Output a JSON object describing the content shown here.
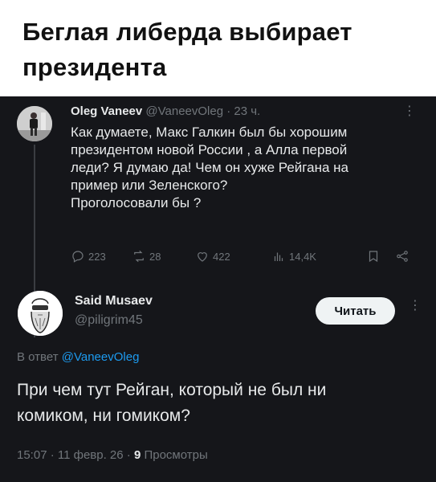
{
  "caption": {
    "title": "Беглая либерда выбирает\nпрезидента"
  },
  "tweet1": {
    "name": "Oleg Vaneev",
    "meta": "@VaneevOleg · 23 ч.",
    "body": "Как думаете, Макс Галкин был бы хорошим\nпрезидентом новой России , а Алла первой\nледи? Я думаю да! Чем он хуже Рейгана на\nпример или Зеленского?\nПроголосовали бы ?",
    "replies": "223",
    "reposts": "28",
    "likes": "422",
    "views": "14,4K"
  },
  "tweet2": {
    "name": "Said Musaev",
    "handle": "@piligrim45",
    "follow_label": "Читать",
    "reply_prefix": "В ответ ",
    "reply_handle": "@VaneevOleg",
    "body": "При чем тут Рейган, который не был ни\nкомиком, ни гомиком?",
    "time": "15:07 · 11 февр. 26 · ",
    "views_count": "9",
    "views_label": " Просмотры"
  },
  "colors": {
    "background": "#15161a",
    "text": "#e7e9ea",
    "muted": "#71767b",
    "link": "#1d9bf0"
  }
}
